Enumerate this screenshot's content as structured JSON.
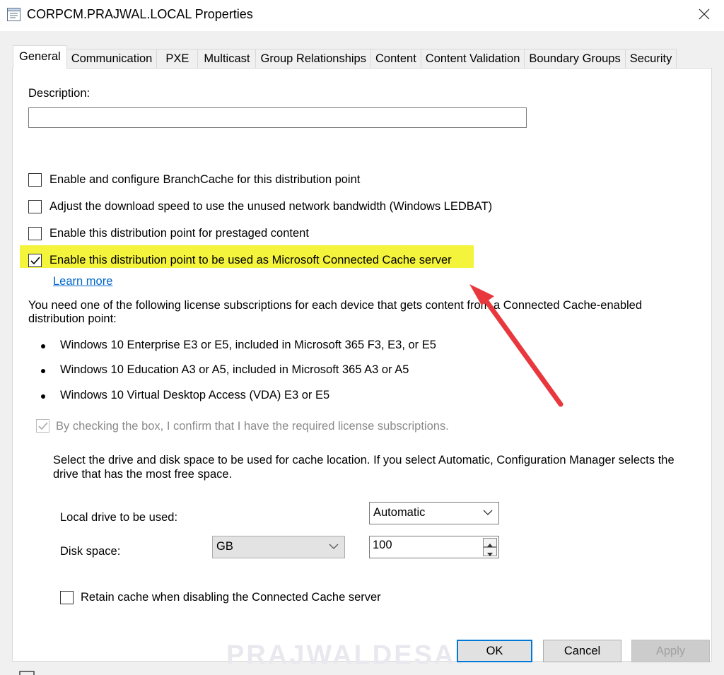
{
  "window": {
    "title": "CORPCM.PRAJWAL.LOCAL Properties"
  },
  "tabs": [
    {
      "label": "General",
      "active": true
    },
    {
      "label": "Communication"
    },
    {
      "label": "PXE"
    },
    {
      "label": "Multicast"
    },
    {
      "label": "Group Relationships"
    },
    {
      "label": "Content"
    },
    {
      "label": "Content Validation"
    },
    {
      "label": "Boundary Groups"
    },
    {
      "label": "Security"
    }
  ],
  "general": {
    "description_label": "Description:",
    "description_value": "",
    "options": [
      {
        "label": "Enable and configure BranchCache for this distribution point",
        "checked": false
      },
      {
        "label": "Adjust the download speed to use the unused network bandwidth (Windows LEDBAT)",
        "checked": false
      },
      {
        "label": "Enable this distribution point for prestaged content",
        "checked": false
      },
      {
        "label": "Enable this distribution point to be used as Microsoft Connected Cache server",
        "checked": true
      }
    ],
    "learn_more": "Learn more",
    "license_text_1": "You need one of the following license subscriptions for each device that gets content from a Connected Cache-enabled",
    "license_text_2": "distribution point:",
    "licenses": [
      "Windows 10 Enterprise E3 or E5, included in Microsoft 365 F3, E3, or E5",
      "Windows 10 Education A3 or A5, included in Microsoft 365 A3 or A5",
      "Windows 10 Virtual Desktop Access (VDA) E3 or E5"
    ],
    "confirm_label": "By checking the box, I confirm that I have the required license subscriptions.",
    "drive_text_1": "Select the drive and disk space to be used for cache location. If you select Automatic, Configuration Manager selects the",
    "drive_text_2": "drive that has the most free space.",
    "local_drive_label": "Local drive to be used:",
    "local_drive_value": "Automatic",
    "disk_space_label": "Disk space:",
    "disk_unit_value": "GB",
    "disk_space_value": "100",
    "retain_label": "Retain cache when disabling the Connected Cache server"
  },
  "buttons": {
    "ok": "OK",
    "cancel": "Cancel",
    "apply": "Apply"
  },
  "watermark": "PRAJWALDESAI",
  "colors": {
    "highlight": "#f4f43c",
    "arrow": "#e8383d",
    "link": "#0066cc",
    "default_button_border": "#0078d7"
  }
}
